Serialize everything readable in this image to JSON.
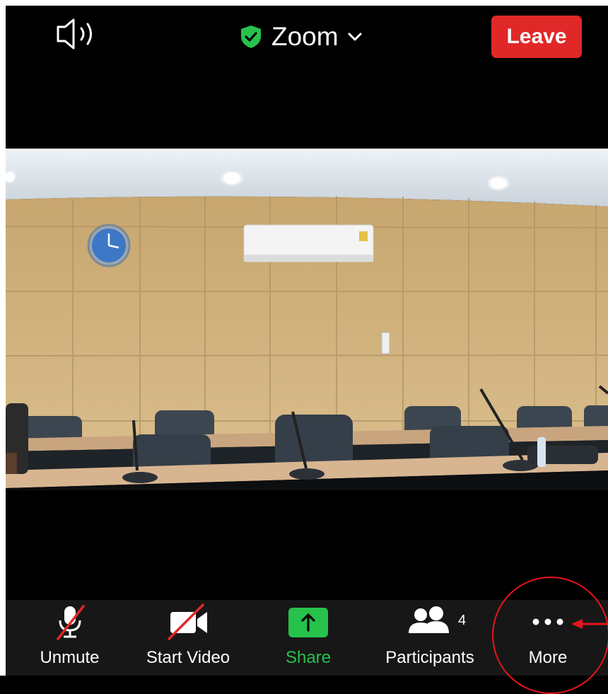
{
  "header": {
    "title": "Zoom",
    "leave_label": "Leave",
    "speaker_icon": "speaker-icon",
    "secure_icon": "shield-check-icon"
  },
  "toolbar": {
    "unmute_label": "Unmute",
    "start_video_label": "Start Video",
    "share_label": "Share",
    "participants_label": "Participants",
    "participants_count": "4",
    "more_label": "More"
  },
  "colors": {
    "leave": "#e02828",
    "share": "#27c24c",
    "toolbar_bg": "#171717",
    "annotation": "#e8141c"
  }
}
